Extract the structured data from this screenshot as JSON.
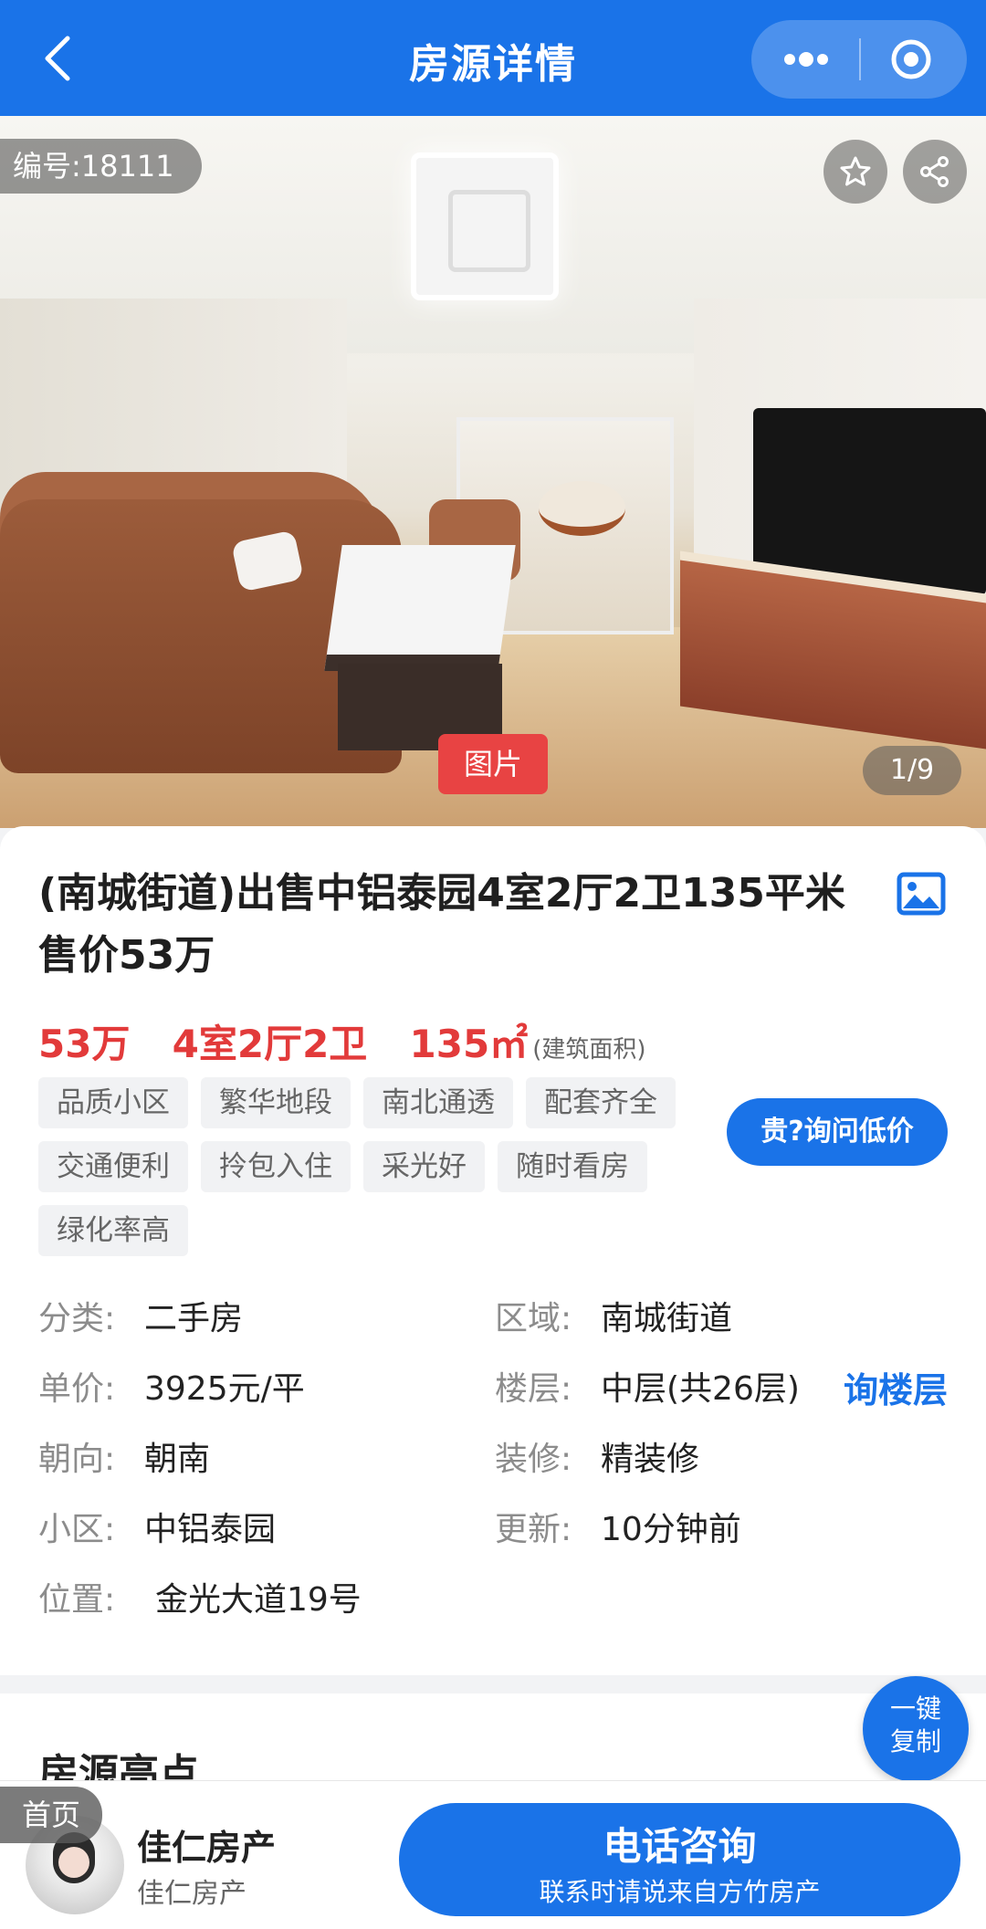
{
  "header": {
    "title": "房源详情",
    "icons": [
      "back-icon",
      "more-icon",
      "circle-target-icon"
    ]
  },
  "photo": {
    "id_badge": "编号:18111",
    "tag": "图片",
    "counter": "1/9",
    "icons": [
      "star-icon",
      "share-icon"
    ]
  },
  "listing": {
    "title": "(南城街道)出售中铝泰园4室2厅2卫135平米 售价53万",
    "price": "53万",
    "layout": "4室2厅2卫",
    "area": "135㎡",
    "area_note": "(建筑面积)",
    "tags": [
      "品质小区",
      "繁华地段",
      "南北通透",
      "配套齐全",
      "交通便利",
      "拎包入住",
      "采光好",
      "随时看房",
      "绿化率高"
    ],
    "inquire_label": "贵?询问低价"
  },
  "info": {
    "category_label": "分类:",
    "category": "二手房",
    "region_label": "区域:",
    "region": "南城街道",
    "unit_price_label": "单价:",
    "unit_price": "3925元/平",
    "floor_label": "楼层:",
    "floor": "中层(共26层)",
    "floor_link": "询楼层",
    "orientation_label": "朝向:",
    "orientation": "朝南",
    "decoration_label": "装修:",
    "decoration": "精装修",
    "community_label": "小区:",
    "community": "中铝泰园",
    "updated_label": "更新:",
    "updated": "10分钟前",
    "location_label": "位置:",
    "location": "金光大道19号"
  },
  "highlights": {
    "title": "房源亮点",
    "copy_line1": "一键",
    "copy_line2": "复制"
  },
  "bottom": {
    "home": "首页",
    "agency": "佳仁房产",
    "agency_sub": "佳仁房产",
    "call_main": "电话咨询",
    "call_sub": "联系时请说来自方竹房产"
  },
  "colors": {
    "primary": "#1a73e8",
    "accent_red": "#e23a3a",
    "tag_bg": "#f1f2f4"
  }
}
